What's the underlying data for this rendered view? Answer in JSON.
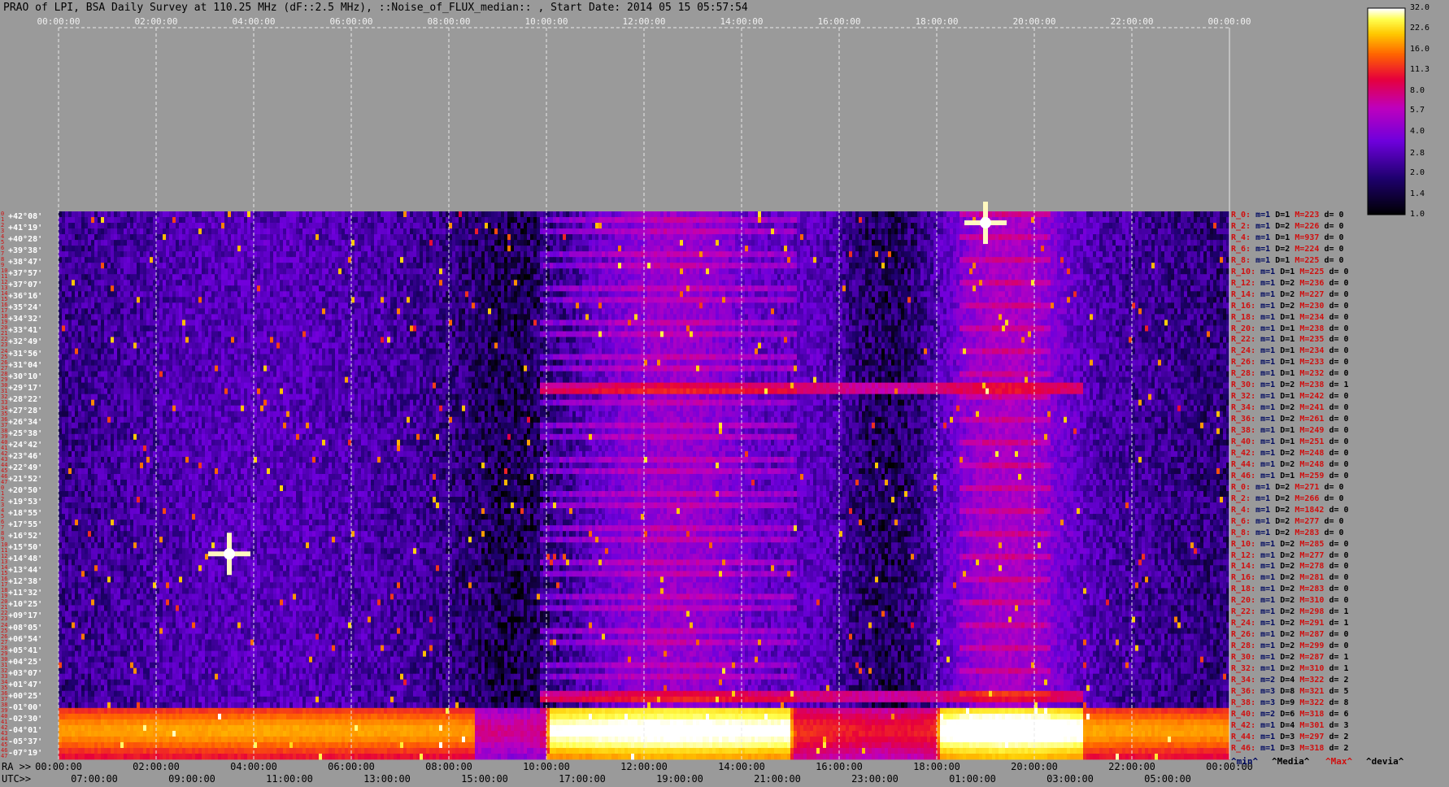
{
  "header": {
    "title": "PRAO of LPI, BSA Daily Survey at 110.25 MHz (dF::2.5 MHz), ::Noise_of_FLUX_median:: , Start Date: 2014 05 15 05:57:54"
  },
  "chart_data": {
    "type": "heatmap",
    "title": "PRAO of LPI, BSA Daily Survey at 110.25 MHz (dF::2.5 MHz), ::Noise_of_FLUX_median:: , Start Date: 2014 05 15 05:57:54",
    "x_top_labels": [
      "00:00:00",
      "02:00:00",
      "04:00:00",
      "06:00:00",
      "08:00:00",
      "10:00:00",
      "12:00:00",
      "14:00:00",
      "16:00:00",
      "18:00:00",
      "20:00:00",
      "22:00:00",
      "00:00:00"
    ],
    "x_ra_labels": [
      "00:00:00",
      "02:00:00",
      "04:00:00",
      "06:00:00",
      "08:00:00",
      "10:00:00",
      "12:00:00",
      "14:00:00",
      "16:00:00",
      "18:00:00",
      "20:00:00",
      "22:00:00",
      "00:00:00"
    ],
    "x_utc_labels": [
      "07:00:00",
      "09:00:00",
      "11:00:00",
      "13:00:00",
      "15:00:00",
      "17:00:00",
      "19:00:00",
      "21:00:00",
      "23:00:00",
      "01:00:00",
      "03:00:00",
      "05:00:00"
    ],
    "ra_axis_label": "RA >>",
    "utc_axis_label": "UTC>>",
    "declinations": [
      "+42°08'",
      "+41°19'",
      "+40°28'",
      "+39°38'",
      "+38°47'",
      "+37°57'",
      "+37°07'",
      "+36°16'",
      "+35°24'",
      "+34°32'",
      "+33°41'",
      "+32°49'",
      "+31°56'",
      "+31°04'",
      "+30°10'",
      "+29°17'",
      "+28°22'",
      "+27°28'",
      "+26°34'",
      "+25°38'",
      "+24°42'",
      "+23°46'",
      "+22°49'",
      "+21°52'",
      "+20°50'",
      "+19°53'",
      "+18°55'",
      "+17°55'",
      "+16°52'",
      "+15°50'",
      "+14°48'",
      "+13°44'",
      "+12°38'",
      "+11°32'",
      "+10°25'",
      "+09°17'",
      "+08°05'",
      "+06°54'",
      "+05°41'",
      "+04°25'",
      "+03°07'",
      "+01°47'",
      "+00°25'",
      "-01°00'",
      "-02°30'",
      "-04°01'",
      "-05°37'",
      "-07°19'"
    ],
    "row_indices": [
      "0",
      "1",
      "2",
      "3",
      "4",
      "5",
      "6",
      "7",
      "8",
      "9",
      "10",
      "11",
      "12",
      "13",
      "14",
      "15",
      "16",
      "17",
      "18",
      "19",
      "20",
      "21",
      "22",
      "23",
      "24",
      "25",
      "26",
      "27",
      "28",
      "29",
      "30",
      "31",
      "32",
      "33",
      "34",
      "35",
      "36",
      "37",
      "38",
      "39",
      "40",
      "41",
      "42",
      "43",
      "44",
      "45",
      "46",
      "47",
      "0",
      "1",
      "2",
      "3",
      "4",
      "5",
      "6",
      "7",
      "8",
      "9",
      "10",
      "11",
      "12",
      "13",
      "14",
      "15",
      "16",
      "17",
      "18",
      "19",
      "20",
      "21",
      "22",
      "23",
      "24",
      "25",
      "26",
      "27",
      "28",
      "29",
      "30",
      "31",
      "32",
      "33",
      "34",
      "35",
      "36",
      "37",
      "38",
      "39",
      "40",
      "41",
      "42",
      "43",
      "44",
      "45",
      "46",
      "47"
    ],
    "colorbar": {
      "ticks": [
        "32.0",
        "22.6",
        "16.0",
        "11.3",
        "8.0",
        "5.7",
        "4.0",
        "2.8",
        "2.0",
        "1.4",
        "1.0"
      ],
      "range": [
        1.0,
        32.0
      ],
      "scale": "log"
    },
    "beam_stats": [
      {
        "r": "R_0:",
        "m": "m=1",
        "D": "D=1",
        "M": "M=223",
        "d": "d= 0"
      },
      {
        "r": "R_2:",
        "m": "m=1",
        "D": "D=2",
        "M": "M=226",
        "d": "d= 0"
      },
      {
        "r": "R_4:",
        "m": "m=1",
        "D": "D=1",
        "M": "M=937",
        "d": "d= 0"
      },
      {
        "r": "R_6:",
        "m": "m=1",
        "D": "D=2",
        "M": "M=224",
        "d": "d= 0"
      },
      {
        "r": "R_8:",
        "m": "m=1",
        "D": "D=1",
        "M": "M=225",
        "d": "d= 0"
      },
      {
        "r": "R_10:",
        "m": "m=1",
        "D": "D=1",
        "M": "M=225",
        "d": "d= 0"
      },
      {
        "r": "R_12:",
        "m": "m=1",
        "D": "D=2",
        "M": "M=236",
        "d": "d= 0"
      },
      {
        "r": "R_14:",
        "m": "m=1",
        "D": "D=2",
        "M": "M=227",
        "d": "d= 0"
      },
      {
        "r": "R_16:",
        "m": "m=1",
        "D": "D=2",
        "M": "M=230",
        "d": "d= 0"
      },
      {
        "r": "R_18:",
        "m": "m=1",
        "D": "D=1",
        "M": "M=234",
        "d": "d= 0"
      },
      {
        "r": "R_20:",
        "m": "m=1",
        "D": "D=1",
        "M": "M=238",
        "d": "d= 0"
      },
      {
        "r": "R_22:",
        "m": "m=1",
        "D": "D=1",
        "M": "M=235",
        "d": "d= 0"
      },
      {
        "r": "R_24:",
        "m": "m=1",
        "D": "D=1",
        "M": "M=234",
        "d": "d= 0"
      },
      {
        "r": "R_26:",
        "m": "m=1",
        "D": "D=1",
        "M": "M=233",
        "d": "d= 0"
      },
      {
        "r": "R_28:",
        "m": "m=1",
        "D": "D=1",
        "M": "M=232",
        "d": "d= 0"
      },
      {
        "r": "R_30:",
        "m": "m=1",
        "D": "D=2",
        "M": "M=238",
        "d": "d= 1"
      },
      {
        "r": "R_32:",
        "m": "m=1",
        "D": "D=1",
        "M": "M=242",
        "d": "d= 0"
      },
      {
        "r": "R_34:",
        "m": "m=1",
        "D": "D=2",
        "M": "M=241",
        "d": "d= 0"
      },
      {
        "r": "R_36:",
        "m": "m=1",
        "D": "D=2",
        "M": "M=261",
        "d": "d= 0"
      },
      {
        "r": "R_38:",
        "m": "m=1",
        "D": "D=1",
        "M": "M=249",
        "d": "d= 0"
      },
      {
        "r": "R_40:",
        "m": "m=1",
        "D": "D=1",
        "M": "M=251",
        "d": "d= 0"
      },
      {
        "r": "R_42:",
        "m": "m=1",
        "D": "D=2",
        "M": "M=248",
        "d": "d= 0"
      },
      {
        "r": "R_44:",
        "m": "m=1",
        "D": "D=2",
        "M": "M=248",
        "d": "d= 0"
      },
      {
        "r": "R_46:",
        "m": "m=1",
        "D": "D=1",
        "M": "M=259",
        "d": "d= 0"
      },
      {
        "r": "R_0:",
        "m": "m=1",
        "D": "D=2",
        "M": "M=271",
        "d": "d= 0"
      },
      {
        "r": "R_2:",
        "m": "m=1",
        "D": "D=2",
        "M": "M=266",
        "d": "d= 0"
      },
      {
        "r": "R_4:",
        "m": "m=1",
        "D": "D=2",
        "M": "M=1842",
        "d": "d= 0"
      },
      {
        "r": "R_6:",
        "m": "m=1",
        "D": "D=2",
        "M": "M=277",
        "d": "d= 0"
      },
      {
        "r": "R_8:",
        "m": "m=1",
        "D": "D=2",
        "M": "M=283",
        "d": "d= 0"
      },
      {
        "r": "R_10:",
        "m": "m=1",
        "D": "D=2",
        "M": "M=285",
        "d": "d= 0"
      },
      {
        "r": "R_12:",
        "m": "m=1",
        "D": "D=2",
        "M": "M=277",
        "d": "d= 0"
      },
      {
        "r": "R_14:",
        "m": "m=1",
        "D": "D=2",
        "M": "M=278",
        "d": "d= 0"
      },
      {
        "r": "R_16:",
        "m": "m=1",
        "D": "D=2",
        "M": "M=281",
        "d": "d= 0"
      },
      {
        "r": "R_18:",
        "m": "m=1",
        "D": "D=2",
        "M": "M=283",
        "d": "d= 0"
      },
      {
        "r": "R_20:",
        "m": "m=1",
        "D": "D=2",
        "M": "M=310",
        "d": "d= 0"
      },
      {
        "r": "R_22:",
        "m": "m=1",
        "D": "D=2",
        "M": "M=298",
        "d": "d= 1"
      },
      {
        "r": "R_24:",
        "m": "m=1",
        "D": "D=2",
        "M": "M=291",
        "d": "d= 1"
      },
      {
        "r": "R_26:",
        "m": "m=1",
        "D": "D=2",
        "M": "M=287",
        "d": "d= 0"
      },
      {
        "r": "R_28:",
        "m": "m=1",
        "D": "D=2",
        "M": "M=299",
        "d": "d= 0"
      },
      {
        "r": "R_30:",
        "m": "m=1",
        "D": "D=2",
        "M": "M=287",
        "d": "d= 1"
      },
      {
        "r": "R_32:",
        "m": "m=1",
        "D": "D=2",
        "M": "M=310",
        "d": "d= 1"
      },
      {
        "r": "R_34:",
        "m": "m=2",
        "D": "D=4",
        "M": "M=322",
        "d": "d= 2"
      },
      {
        "r": "R_36:",
        "m": "m=3",
        "D": "D=8",
        "M": "M=321",
        "d": "d= 5"
      },
      {
        "r": "R_38:",
        "m": "m=3",
        "D": "D=9",
        "M": "M=322",
        "d": "d= 8"
      },
      {
        "r": "R_40:",
        "m": "m=2",
        "D": "D=6",
        "M": "M=318",
        "d": "d= 6"
      },
      {
        "r": "R_42:",
        "m": "m=1",
        "D": "D=4",
        "M": "M=301",
        "d": "d= 3"
      },
      {
        "r": "R_44:",
        "m": "m=1",
        "D": "D=3",
        "M": "M=297",
        "d": "d= 2"
      },
      {
        "r": "R_46:",
        "m": "m=1",
        "D": "D=3",
        "M": "M=318",
        "d": "d= 2"
      }
    ],
    "legend": [
      {
        "label": "^min^",
        "color": "#000a60"
      },
      {
        "label": "^Media^",
        "color": "#000000"
      },
      {
        "label": "^Max^",
        "color": "#d01010"
      },
      {
        "label": "^devia^",
        "color": "#000000"
      }
    ]
  }
}
